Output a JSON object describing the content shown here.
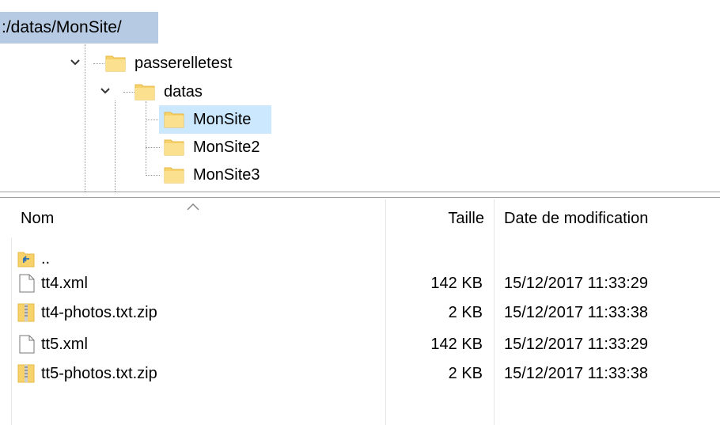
{
  "path_bar": {
    "text": ":/datas/MonSite/"
  },
  "tree": {
    "items": [
      {
        "label": "passerelletest"
      },
      {
        "label": "datas"
      },
      {
        "label": "MonSite",
        "selected": true
      },
      {
        "label": "MonSite2"
      },
      {
        "label": "MonSite3"
      }
    ]
  },
  "list": {
    "columns": {
      "name": "Nom",
      "size": "Taille",
      "date": "Date de modification"
    },
    "rows": [
      {
        "name": "..",
        "size": "",
        "date": "",
        "icon": "parent-folder-icon"
      },
      {
        "name": "tt4.xml",
        "size": "142 KB",
        "date": "15/12/2017 11:33:29",
        "icon": "file-icon"
      },
      {
        "name": "tt4-photos.txt.zip",
        "size": "2 KB",
        "date": "15/12/2017 11:33:38",
        "icon": "zip-icon"
      },
      {
        "name": "tt5.xml",
        "size": "142 KB",
        "date": "15/12/2017 11:33:29",
        "icon": "file-icon"
      },
      {
        "name": "tt5-photos.txt.zip",
        "size": "2 KB",
        "date": "15/12/2017 11:33:38",
        "icon": "zip-icon"
      }
    ]
  },
  "colors": {
    "selection": "#cce8ff",
    "path_bar": "#b6cbe3",
    "folder": "#f7d26b"
  }
}
